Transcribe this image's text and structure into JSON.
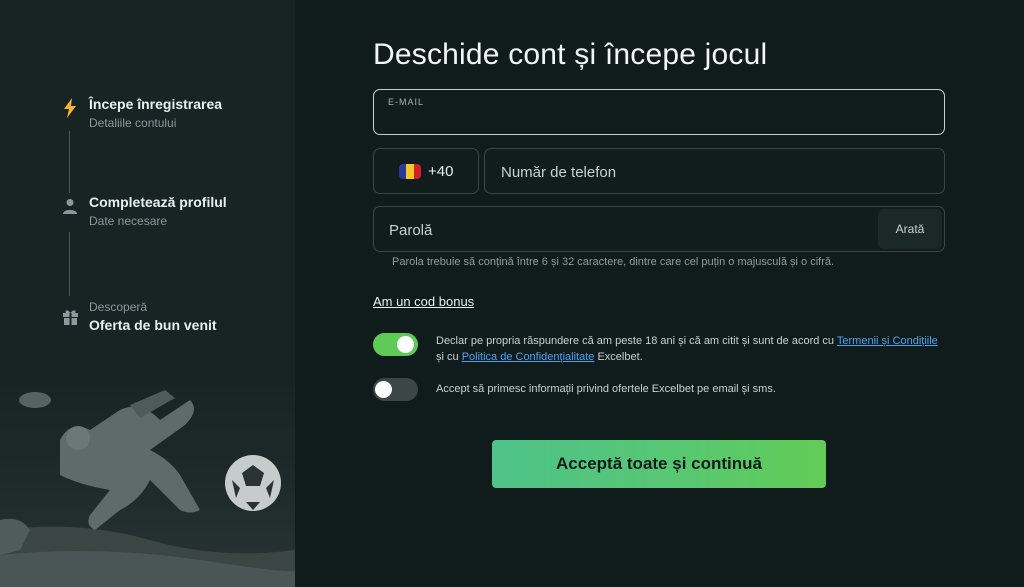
{
  "steps": [
    {
      "title": "Începe înregistrarea",
      "subtitle": "Detaliile contului",
      "icon": "lightning-icon",
      "active": true
    },
    {
      "title": "Completează profilul",
      "subtitle": "Date necesare",
      "icon": "user-icon",
      "active": false
    },
    {
      "pre_title": "Descoperă",
      "title": "Oferta de bun venit",
      "icon": "gift-icon",
      "active": false
    }
  ],
  "form": {
    "title": "Deschide cont și începe jocul",
    "email_label": "E-MAIL",
    "email_value": "",
    "phone_prefix": "+40",
    "phone_placeholder": "Număr de telefon",
    "password_placeholder": "Parolă",
    "show_password_label": "Arată",
    "password_hint": "Parola trebuie să conțină între 6 și 32 caractere, dintre care cel puțin o majusculă și o cifră.",
    "bonus_link": "Am un cod bonus",
    "consent_terms": {
      "enabled": true,
      "text_before": "Declar pe propria răspundere că am peste 18 ani și că am citit și sunt de acord cu ",
      "terms_link": "Termenii și Condițiile",
      "text_middle": " și cu ",
      "privacy_link": "Politica de Confidențialitate",
      "text_after": " Excelbet."
    },
    "consent_marketing": {
      "enabled": false,
      "text": "Accept să primesc informații privind ofertele Excelbet pe email și sms."
    },
    "submit_label": "Acceptă toate și continuă"
  },
  "colors": {
    "background": "#101b1b",
    "sidebar": "#182324",
    "accent_green": "#5ecb58",
    "active_step_icon": "#f5b731",
    "link_blue": "#4da3f0"
  },
  "flag_colors": [
    "#2b3a9a",
    "#f7c824",
    "#d4202a"
  ]
}
